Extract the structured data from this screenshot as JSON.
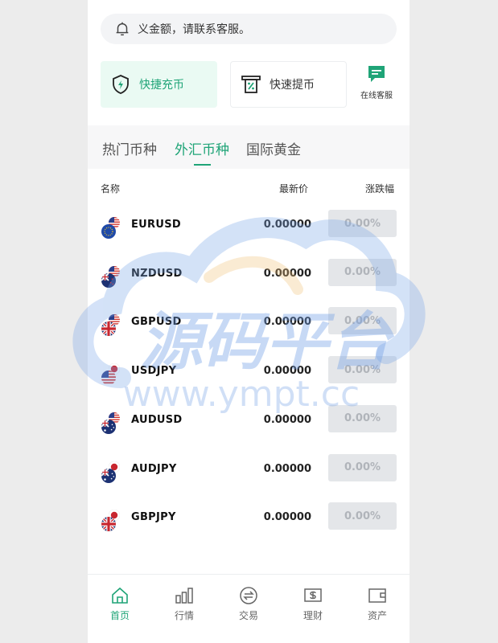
{
  "notice": {
    "text": "义金额，请联系客服。",
    "icon": "bell-icon"
  },
  "quick": {
    "recharge": {
      "label": "快捷充币",
      "icon": "shield-bolt-icon"
    },
    "withdraw": {
      "label": "快速提币",
      "icon": "withdraw-cash-icon"
    },
    "service": {
      "label": "在线客服",
      "icon": "chat-icon"
    }
  },
  "tabs": [
    {
      "label": "热门币种",
      "active": false
    },
    {
      "label": "外汇币种",
      "active": true
    },
    {
      "label": "国际黄金",
      "active": false
    }
  ],
  "table": {
    "headers": {
      "name": "名称",
      "price": "最新价",
      "change": "涨跌幅"
    },
    "rows": [
      {
        "symbol": "EURUSD",
        "price": "0.00000",
        "change": "0.00%",
        "base_flag": "eu-flag-icon",
        "quote_flag": "us-flag-icon"
      },
      {
        "symbol": "NZDUSD",
        "price": "0.00000",
        "change": "0.00%",
        "base_flag": "nz-flag-icon",
        "quote_flag": "us-flag-icon"
      },
      {
        "symbol": "GBPUSD",
        "price": "0.00000",
        "change": "0.00%",
        "base_flag": "uk-flag-icon",
        "quote_flag": "us-flag-icon"
      },
      {
        "symbol": "USDJPY",
        "price": "0.00000",
        "change": "0.00%",
        "base_flag": "us-flag-icon",
        "quote_flag": "jp-flag-icon"
      },
      {
        "symbol": "AUDUSD",
        "price": "0.00000",
        "change": "0.00%",
        "base_flag": "au-flag-icon",
        "quote_flag": "us-flag-icon"
      },
      {
        "symbol": "AUDJPY",
        "price": "0.00000",
        "change": "0.00%",
        "base_flag": "au-flag-icon",
        "quote_flag": "jp-flag-icon"
      },
      {
        "symbol": "GBPJPY",
        "price": "0.00000",
        "change": "0.00%",
        "base_flag": "uk-flag-icon",
        "quote_flag": "jp-flag-icon"
      }
    ]
  },
  "watermark": {
    "title": "源码平台",
    "url": "www.ympt.cc"
  },
  "tabbar": [
    {
      "label": "首页",
      "icon": "home-icon",
      "active": true
    },
    {
      "label": "行情",
      "icon": "bar-chart-icon",
      "active": false
    },
    {
      "label": "交易",
      "icon": "exchange-icon",
      "active": false
    },
    {
      "label": "理财",
      "icon": "finance-icon",
      "active": false
    },
    {
      "label": "资产",
      "icon": "wallet-icon",
      "active": false
    }
  ],
  "colors": {
    "accent": "#1fa477",
    "change_bg": "#e4e6e9",
    "change_text": "#b0b4ba"
  }
}
